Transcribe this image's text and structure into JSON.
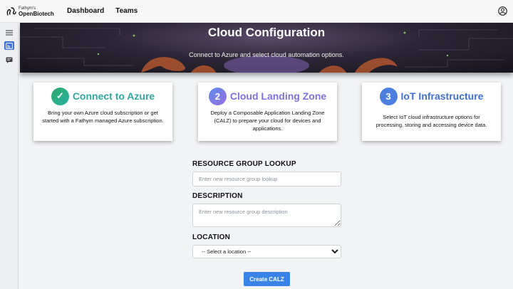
{
  "brand": {
    "line1": "Fathym's",
    "line2": "OpenBiotech"
  },
  "nav": {
    "dashboard": "Dashboard",
    "teams": "Teams"
  },
  "icons": {
    "account": "account-circle-icon",
    "menu": "hamburger-menu-icon",
    "cloud": "cast-icon",
    "chat": "chat-icon"
  },
  "hero": {
    "title": "Cloud Configuration",
    "subtitle": "Connect to Azure and select cloud automation options."
  },
  "steps": [
    {
      "badge": "✓",
      "title": "Connect to Azure",
      "description": "Bring your own Azure cloud subscription or get started with a Fathym managed Azure subscription."
    },
    {
      "badge": "2",
      "title": "Cloud Landing Zone",
      "description": "Deploy a Composable Application Landing Zone (CALZ) to prepare your cloud for devices and applications."
    },
    {
      "badge": "3",
      "title": "IoT Infrastructure",
      "description": "Select IoT cloud infrastructure options for processing, storing and accessing device data."
    }
  ],
  "form": {
    "resource_group_label": "RESOURCE GROUP LOOKUP",
    "resource_group_placeholder": "Enter new resource group lookup",
    "description_label": "DESCRIPTION",
    "description_placeholder": "Enter new resource group description",
    "location_label": "LOCATION",
    "location_selected": "-- Select a location --",
    "submit_label": "Create CALZ"
  },
  "colors": {
    "accent": "#3a84e8",
    "step1": "#2fa9a0",
    "step2": "#7d72e2",
    "step3": "#3e6fd6"
  }
}
